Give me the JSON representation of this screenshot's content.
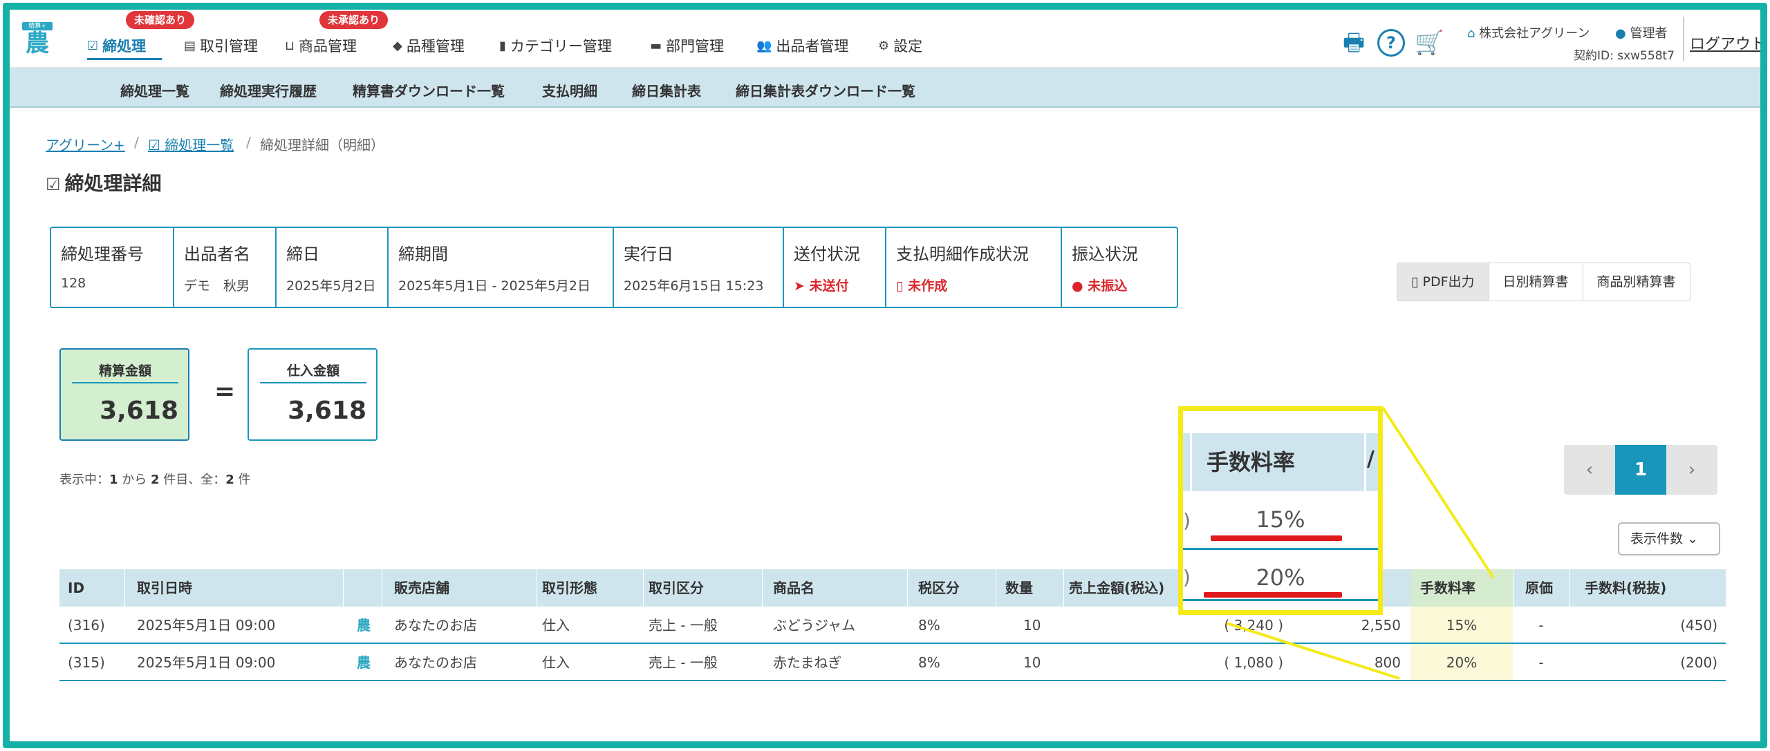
{
  "nav": {
    "logo_tag": "精算+",
    "logo_char": "農",
    "items": [
      {
        "label": "締処理",
        "icon": "check-circle-icon",
        "badge": "未確認あり",
        "active": true
      },
      {
        "label": "取引管理",
        "icon": "ledger-icon"
      },
      {
        "label": "商品管理",
        "icon": "basket-icon",
        "badge": "未承認あり"
      },
      {
        "label": "品種管理",
        "icon": "tag-icon"
      },
      {
        "label": "カテゴリー管理",
        "icon": "bookmark-icon"
      },
      {
        "label": "部門管理",
        "icon": "folder-icon"
      },
      {
        "label": "出品者管理",
        "icon": "users-icon"
      },
      {
        "label": "設定",
        "icon": "gear-icon"
      }
    ],
    "right": {
      "company": "株式会社アグリーン",
      "role": "管理者",
      "contract": "契約ID: sxw558t7",
      "logout": "ログアウト",
      "help": "?"
    }
  },
  "subnav": {
    "items": [
      "締処理一覧",
      "締処理実行履歴",
      "精算書ダウンロード一覧",
      "支払明細",
      "締日集計表",
      "締日集計表ダウンロード一覧"
    ]
  },
  "breadcrumb": {
    "home": "アグリーン+",
    "sep": "/",
    "list": "締処理一覧",
    "current": "締処理詳細（明細）"
  },
  "page_title": "締処理詳細",
  "info": {
    "closing_no_h": "締処理番号",
    "closing_no": "128",
    "seller_h": "出品者名",
    "seller": "デモ　秋男",
    "close_date_h": "締日",
    "close_date": "2025年5月2日",
    "period_h": "締期間",
    "period": "2025年5月1日 - 2025年5月2日",
    "exec_date_h": "実行日",
    "exec_date": "2025年6月15日 15:23",
    "send_h": "送付状況",
    "send": "未送付",
    "statement_h": "支払明細作成状況",
    "statement": "未作成",
    "transfer_h": "振込状況",
    "transfer": "未振込"
  },
  "buttons": {
    "pdf": "PDF出力",
    "daily": "日別精算書",
    "by_product": "商品別精算書"
  },
  "summary": {
    "settlement_label": "精算金額",
    "settlement": "3,618",
    "equals": "=",
    "purchase_label": "仕入金額",
    "purchase": "3,618"
  },
  "showing": {
    "prefix": "表示中：",
    "from": "1",
    "mid1": " から ",
    "to": "2",
    "mid2": " 件目、全：",
    "total": "2",
    "suffix": " 件"
  },
  "pager": {
    "prev": "‹",
    "current": "1",
    "next": "›"
  },
  "per_page": "表示件数",
  "table": {
    "headers": [
      "ID",
      "取引日時",
      "",
      "販売店舗",
      "取引形態",
      "取引区分",
      "商品名",
      "税区分",
      "数量",
      "売上金額(税込)",
      "",
      "手数料率",
      "原価",
      "手数料(税抜)"
    ],
    "rows": [
      {
        "id": "(316)",
        "datetime": "2025年5月1日 09:00",
        "mark": "農",
        "store": "あなたのお店",
        "type": "仕入",
        "category": "売上 - 一般",
        "product": "ぶどうジャム",
        "tax": "8%",
        "qty": "10",
        "sales": "( 3,240 )",
        "amount": "2,550",
        "rate": "15%",
        "cost": "-",
        "fee": "(450)"
      },
      {
        "id": "(315)",
        "datetime": "2025年5月1日 09:00",
        "mark": "農",
        "store": "あなたのお店",
        "type": "仕入",
        "category": "売上 - 一般",
        "product": "赤たまねぎ",
        "tax": "8%",
        "qty": "10",
        "sales": "( 1,080 )",
        "amount": "800",
        "rate": "20%",
        "cost": "-",
        "fee": "(200)"
      }
    ]
  },
  "zoom": {
    "header": "手数料率",
    "edge_left": ")",
    "edge_right": "/",
    "values": [
      "15%",
      "20%"
    ]
  },
  "colors": {
    "accent": "#1a96ba",
    "frame": "#16b1a6",
    "highlight": "#f4ea1a",
    "underline_red": "#e0191c",
    "alert": "#e0353a"
  }
}
